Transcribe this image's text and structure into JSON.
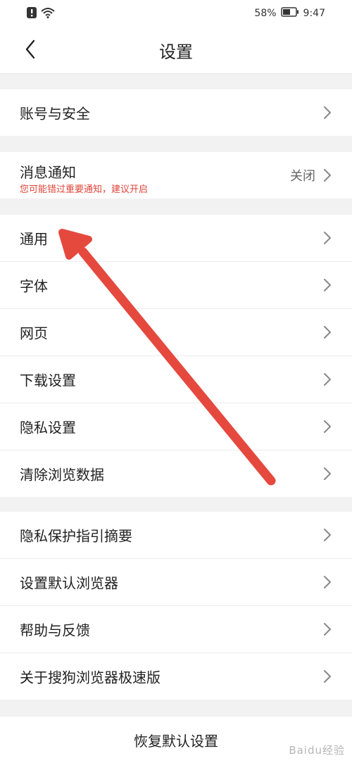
{
  "status_bar": {
    "battery": "58%",
    "time": "9:47"
  },
  "header": {
    "title": "设置"
  },
  "account": {
    "label": "账号与安全"
  },
  "notify": {
    "label": "消息通知",
    "warning": "您可能错过重要通知，建议开启",
    "value": "关闭"
  },
  "general_group": [
    "通用",
    "字体",
    "网页",
    "下载设置",
    "隐私设置",
    "清除浏览数据"
  ],
  "about_group": [
    "隐私保护指引摘要",
    "设置默认浏览器",
    "帮助与反馈",
    "关于搜狗浏览器极速版"
  ],
  "reset": {
    "label": "恢复默认设置"
  },
  "watermark": "Baidu经验",
  "colors": {
    "accent_red": "#e0463b",
    "background": "#f2f2f2"
  }
}
